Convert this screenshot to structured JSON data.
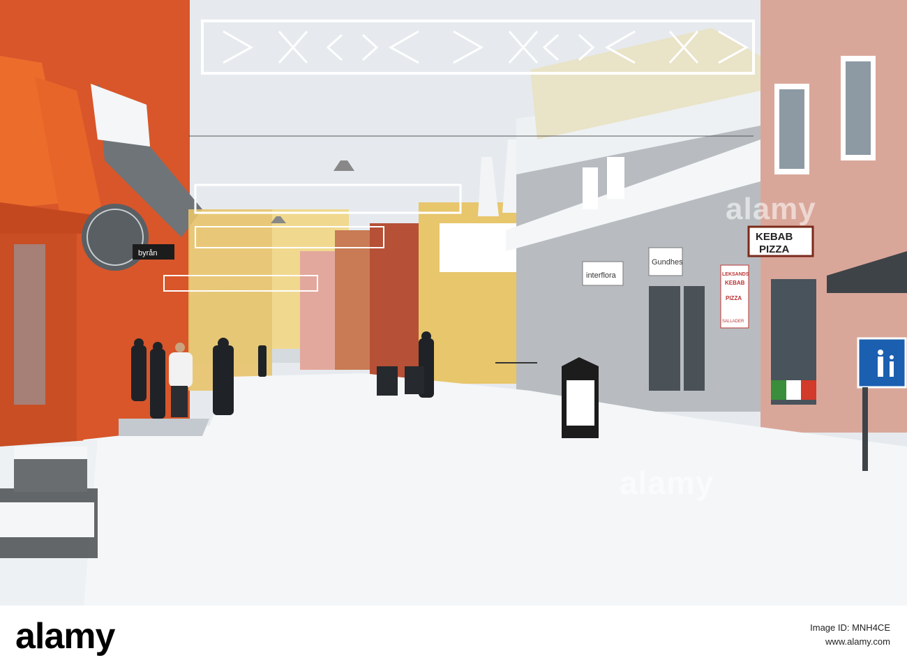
{
  "watermarks": {
    "top_right": "alamy",
    "center": "alamy"
  },
  "signs": {
    "kebab_pizza": [
      "KEBAB",
      "PIZZA"
    ],
    "leksands": [
      "LEKSANDS",
      "KEBAB",
      "PIZZA",
      "SALLADER"
    ],
    "interflora": "interflora",
    "clothes": "Gundhes",
    "byran": "byrån"
  },
  "footer": {
    "logo": "alamy",
    "image_id_label": "Image ID: MNH4CE",
    "site": "www.alamy.com"
  },
  "palette": {
    "snow": "#f4f6f8",
    "sky": "#e8ecef",
    "orange": "#e2652a",
    "pink_building": "#d9a79a"
  }
}
